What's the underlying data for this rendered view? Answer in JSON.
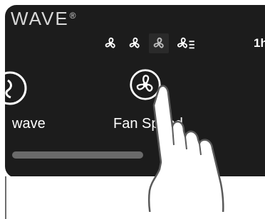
{
  "brand": {
    "name": "WAVE",
    "mark": "®"
  },
  "toolbar": {
    "speeds": [
      {
        "name": "fan-speed-low-icon",
        "selected": false
      },
      {
        "name": "fan-speed-medium-icon",
        "selected": false
      },
      {
        "name": "fan-speed-high-icon",
        "selected": true
      },
      {
        "name": "fan-speed-auto-icon",
        "selected": false
      }
    ],
    "timer": "1h"
  },
  "modes": {
    "left": {
      "label": "wave"
    },
    "center": {
      "label": "Fan Speed"
    }
  },
  "colors": {
    "panel": "#1c1c1c",
    "text": "#ffffff",
    "track": "#6a6a6a"
  }
}
